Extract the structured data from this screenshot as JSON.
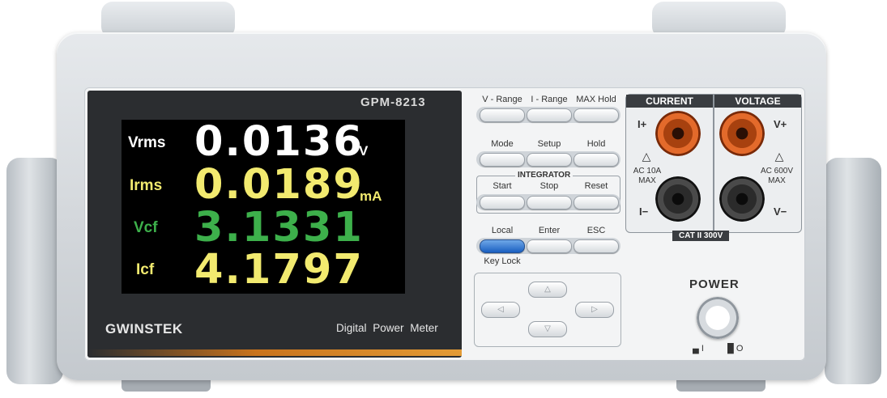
{
  "device": {
    "model": "GPM-8213",
    "brand": "GWINSTEK",
    "type_label": "Digital Power Meter"
  },
  "display": {
    "rows": [
      {
        "label": "Vrms",
        "value": "0.0136",
        "unit": "V",
        "color": "#ffffff"
      },
      {
        "label": "Irms",
        "value": "0.0189",
        "unit": "mA",
        "color": "#f2ea6f"
      },
      {
        "label": "Vcf",
        "value": "3.1331",
        "unit": "",
        "color": "#3db04b"
      },
      {
        "label": "Icf",
        "value": "4.1797",
        "unit": "",
        "color": "#f2ea6f"
      }
    ]
  },
  "keys": {
    "v_range": "V - Range",
    "i_range": "I - Range",
    "max_hold": "MAX Hold",
    "mode": "Mode",
    "setup": "Setup",
    "hold": "Hold",
    "integrator": "INTEGRATOR",
    "start": "Start",
    "stop": "Stop",
    "reset": "Reset",
    "local": "Local",
    "enter": "Enter",
    "esc": "ESC",
    "key_lock": "Key Lock"
  },
  "terminals": {
    "current_header": "CURRENT",
    "voltage_header": "VOLTAGE",
    "i_plus": "I+",
    "i_minus": "I−",
    "v_plus": "V+",
    "v_minus": "V−",
    "current_rating": "AC 10A",
    "voltage_rating": "AC 600V",
    "max": "MAX",
    "category": "CAT II 300V"
  },
  "power": {
    "label": "POWER",
    "on_symbol": "I",
    "off_symbol": "O"
  },
  "colors": {
    "accent_orange": "#e39b36",
    "key_lock_blue": "#1a5fc0",
    "jack_red": "#e36a2b"
  },
  "icons": [
    "warning-triangle-icon",
    "arrow-up-icon",
    "arrow-down-icon",
    "arrow-left-icon",
    "arrow-right-icon"
  ]
}
